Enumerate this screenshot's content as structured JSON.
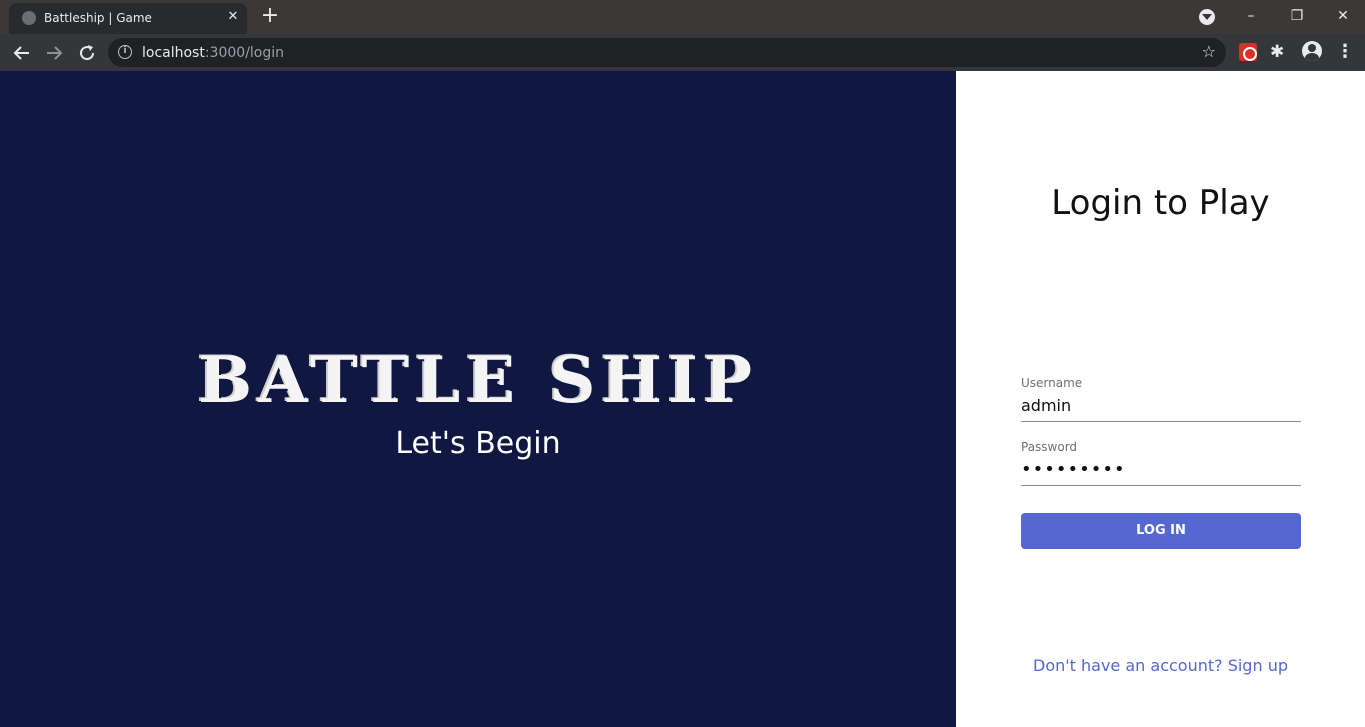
{
  "browser": {
    "tab_title": "Battleship | Game",
    "tab_close": "✕",
    "new_tab": "+",
    "url_host": "localhost",
    "url_path": ":3000/login",
    "window_controls": {
      "minimize": "–",
      "restore": "❐",
      "close": "✕"
    }
  },
  "hero": {
    "logo_text": "BATTLE SHIP",
    "tagline": "Let's Begin"
  },
  "login": {
    "heading": "Login to Play",
    "username_label": "Username",
    "username_value": "admin",
    "password_label": "Password",
    "password_value": "•••••••••",
    "submit_label": "LOG IN",
    "signup_link": "Don't have an account? Sign up"
  },
  "colors": {
    "hero_bg": "#101740",
    "accent": "#5567d0",
    "panel_bg": "#ffffff"
  }
}
